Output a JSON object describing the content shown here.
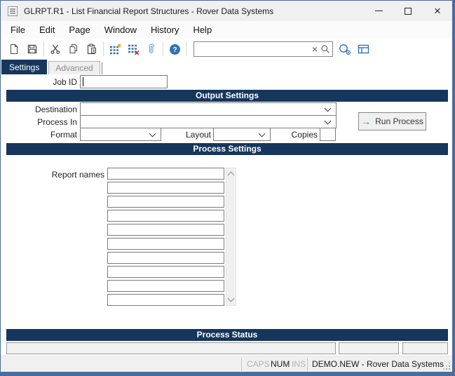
{
  "window": {
    "title": "GLRPT.R1 - List Financial Report Structures - Rover Data Systems"
  },
  "menu": {
    "items": [
      "File",
      "Edit",
      "Page",
      "Window",
      "History",
      "Help"
    ]
  },
  "toolbar": {
    "search": {
      "value": "",
      "placeholder": ""
    },
    "icons": [
      "new-document",
      "save",
      "cut",
      "copy",
      "paste",
      "insert-row",
      "delete-row",
      "attachment",
      "help",
      "clear-search",
      "search",
      "zoom-preview",
      "table-layout"
    ]
  },
  "tabs": {
    "settings": "Settings",
    "advanced": "Advanced"
  },
  "form": {
    "job_id_label": "Job ID",
    "job_id_value": "",
    "output_section_title": "Output Settings",
    "destination_label": "Destination",
    "destination_value": "",
    "process_in_label": "Process In",
    "process_in_value": "",
    "format_label": "Format",
    "format_value": "",
    "layout_label": "Layout",
    "layout_value": "",
    "copies_label": "Copies",
    "copies_value": "",
    "run_process_label": "Run Process",
    "run_arrow_glyph": "→",
    "process_section_title": "Process Settings",
    "report_names_label": "Report names",
    "report_names": [
      "",
      "",
      "",
      "",
      "",
      "",
      "",
      "",
      "",
      ""
    ],
    "status_section_title": "Process Status",
    "status_fields": [
      "",
      "",
      ""
    ]
  },
  "status_bar": {
    "caps": "CAPS",
    "num": "NUM",
    "ins": "INS",
    "session": "DEMO.NEW - Rover Data Systems"
  },
  "colors": {
    "section_header_navy": "#16365c",
    "window_border_blue": "#4a6d9b",
    "toolbar_icon_blue": "#2e75b6",
    "run_arrow_green": "#2da44e",
    "titlebar_grey": "#f0f0f0"
  }
}
